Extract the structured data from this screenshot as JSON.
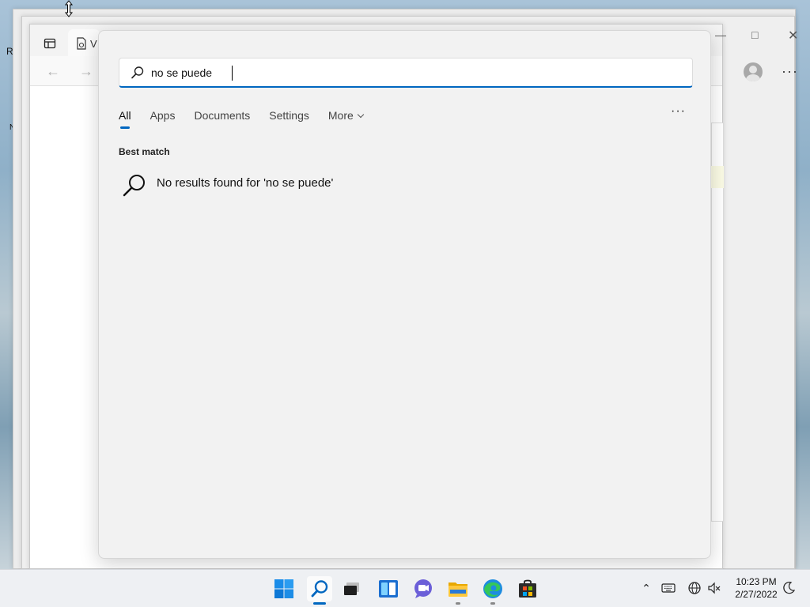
{
  "search": {
    "query": "no se puede",
    "tabs": [
      {
        "label": "All"
      },
      {
        "label": "Apps"
      },
      {
        "label": "Documents"
      },
      {
        "label": "Settings"
      },
      {
        "label": "More"
      }
    ],
    "more_options": "···",
    "best_match_title": "Best match",
    "no_results_text": "No results found for 'no se puede'"
  },
  "background_window": {
    "tab_label_fragment": "V",
    "menu_dots": "···"
  },
  "desktop": {
    "edge_letters": [
      "R",
      "N"
    ]
  },
  "taskbar": {
    "icons": [
      "start-icon",
      "search-icon",
      "task-view-icon",
      "widgets-icon",
      "chat-icon",
      "file-explorer-icon",
      "edge-icon",
      "store-icon"
    ],
    "accent": "#0067c0"
  },
  "system_tray": {
    "time": "10:23 PM",
    "date": "2/27/2022"
  }
}
